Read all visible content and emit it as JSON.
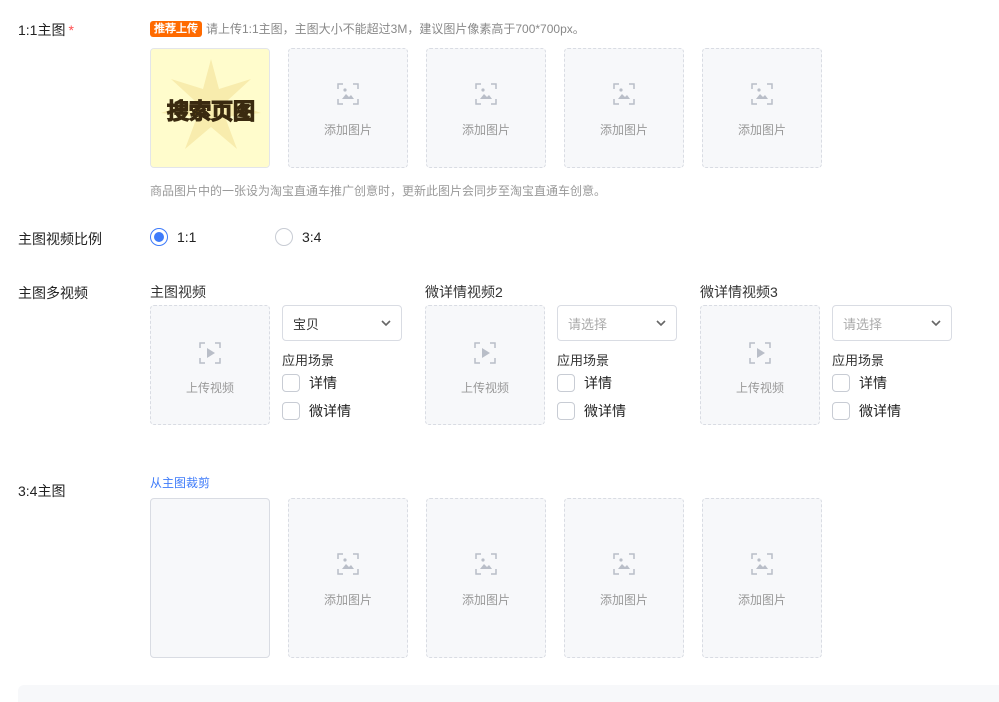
{
  "main_image": {
    "label": "1:1主图",
    "required_mark": "*",
    "badge": "推荐上传",
    "tip": "请上传1:1主图，主图大小不能超过3M，建议图片像素高于700*700px。",
    "thumb_text": "搜索页图",
    "add_label": "添加图片",
    "note": "商品图片中的一张设为淘宝直通车推广创意时，更新此图片会同步至淘宝直通车创意。"
  },
  "ratio": {
    "label": "主图视频比例",
    "options": [
      "1:1",
      "3:4"
    ],
    "selected": "1:1"
  },
  "videos": {
    "label": "主图多视频",
    "upload_label": "上传视频",
    "scene_label": "应用场景",
    "scene_options": [
      "详情",
      "微详情"
    ],
    "slots": [
      {
        "title": "主图视频",
        "select_value": "宝贝",
        "placeholder": ""
      },
      {
        "title": "微详情视频2",
        "select_value": "",
        "placeholder": "请选择"
      },
      {
        "title": "微详情视频3",
        "select_value": "",
        "placeholder": "请选择"
      }
    ]
  },
  "portrait": {
    "label": "3:4主图",
    "crop_link": "从主图裁剪",
    "add_label": "添加图片"
  },
  "colors": {
    "accent": "#3e7bfa",
    "badge": "#ff6a00",
    "required": "#ff4d4f"
  }
}
